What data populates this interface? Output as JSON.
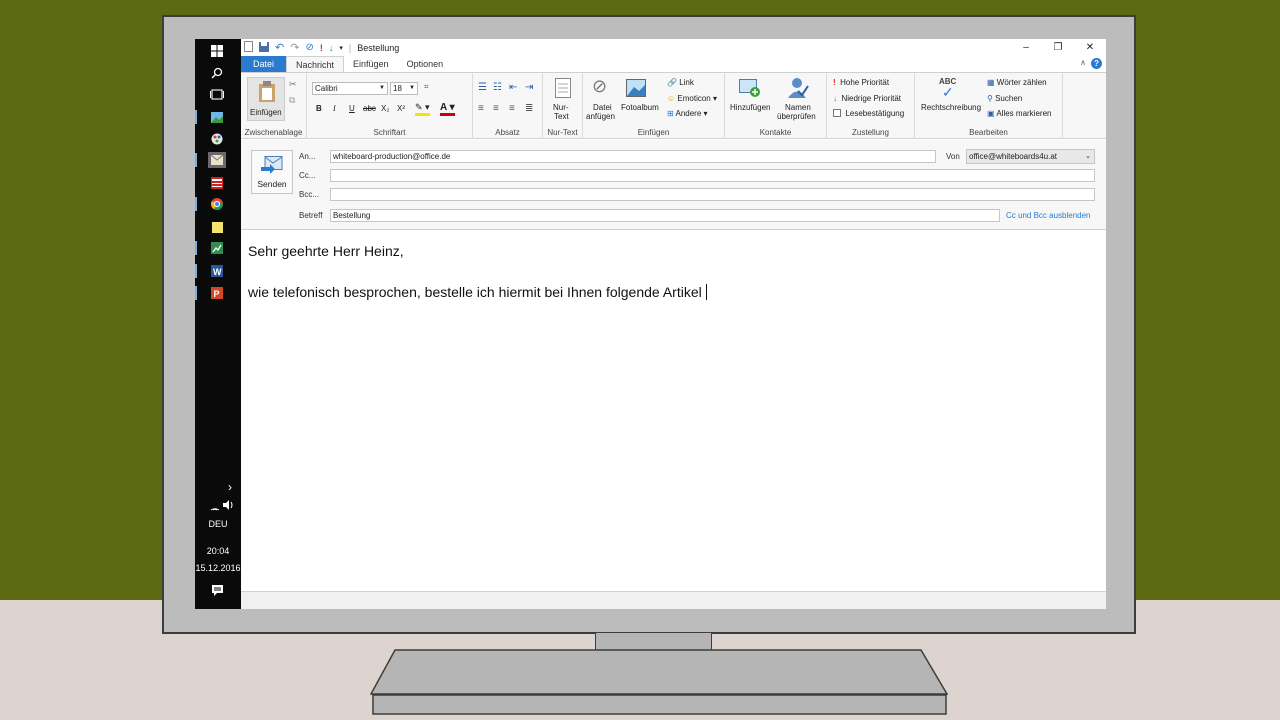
{
  "window": {
    "title": "Bestellung"
  },
  "taskbar": {
    "language": "DEU",
    "time": "20:04",
    "date": "15.12.2016",
    "icons": [
      "windows-start-icon",
      "search-icon",
      "task-view-icon",
      "photos-icon",
      "paint-icon",
      "mail-icon",
      "news-icon",
      "chrome-icon",
      "sticky-notes-icon",
      "excel-icon",
      "word-icon",
      "powerpoint-icon"
    ]
  },
  "tabs": [
    "Datei",
    "Nachricht",
    "Einfügen",
    "Optionen"
  ],
  "ribbon": {
    "clipboard": {
      "paste": "Einfügen",
      "label": "Zwischenablage"
    },
    "font": {
      "name": "Calibri",
      "size": "18",
      "label": "Schriftart",
      "bold": "B",
      "italic": "I",
      "underline": "U",
      "strike": "abc",
      "sub": "X₂",
      "sup": "X²"
    },
    "paragraph": {
      "label": "Absatz"
    },
    "plaintext": {
      "line1": "Nur-",
      "line2": "Text",
      "label": "Nur-Text"
    },
    "insert": {
      "attach1": "Datei",
      "attach2": "anfügen",
      "album": "Fotoalbum",
      "link": "Link",
      "emoticon": "Emoticon",
      "other": "Andere",
      "label": "Einfügen"
    },
    "contacts": {
      "add": "Hinzufügen",
      "check1": "Namen",
      "check2": "überprüfen",
      "label": "Kontakte"
    },
    "delivery": {
      "high": "Hohe Priorität",
      "low": "Niedrige Priorität",
      "receipt": "Lesebestätigung",
      "label": "Zustellung"
    },
    "editing": {
      "spell": "Rechtschreibung",
      "abc": "ABC",
      "count": "Wörter zählen",
      "find": "Suchen",
      "selectall": "Alles markieren",
      "label": "Bearbeiten"
    }
  },
  "header": {
    "send": "Senden",
    "to_label": "An...",
    "to_value": "whiteboard-production@office.de",
    "cc_label": "Cc...",
    "cc_value": "",
    "bcc_label": "Bcc...",
    "bcc_value": "",
    "subject_label": "Betreff",
    "subject_value": "Bestellung",
    "from_label": "Von",
    "from_value": "office@whiteboards4u.at",
    "toggle_cc": "Cc und Bcc ausblenden"
  },
  "body": {
    "line1": "Sehr geehrte Herr Heinz,",
    "line2": "wie telefonisch besprochen, bestelle ich hiermit bei Ihnen folgende Artikel"
  }
}
